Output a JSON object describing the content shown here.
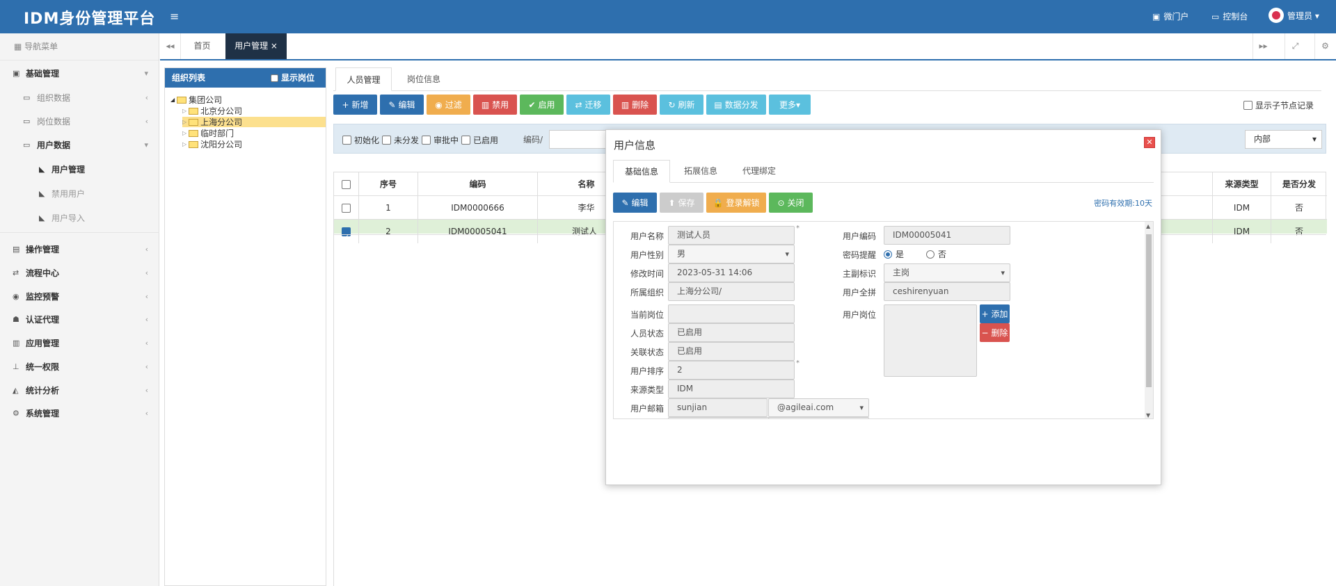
{
  "header": {
    "brand": "IDM身份管理平台",
    "menu_icon": "≡",
    "portal": "微门户",
    "console": "控制台",
    "user": "管理员 ▾"
  },
  "sidebar": {
    "title": "导航菜单",
    "groups": [
      {
        "label": "基础管理",
        "arrow": "▾"
      },
      {
        "label": "组织数据",
        "arrow": "‹"
      },
      {
        "label": "岗位数据",
        "arrow": "‹"
      },
      {
        "label": "用户数据",
        "arrow": "▾"
      },
      {
        "label": "用户管理"
      },
      {
        "label": "禁用用户"
      },
      {
        "label": "用户导入"
      },
      {
        "label": "操作管理",
        "arrow": "‹"
      },
      {
        "label": "流程中心",
        "arrow": "‹"
      },
      {
        "label": "监控预警",
        "arrow": "‹"
      },
      {
        "label": "认证代理",
        "arrow": "‹"
      },
      {
        "label": "应用管理",
        "arrow": "‹"
      },
      {
        "label": "统一权限",
        "arrow": "‹"
      },
      {
        "label": "统计分析",
        "arrow": "‹"
      },
      {
        "label": "系统管理",
        "arrow": "‹"
      }
    ]
  },
  "tabs": {
    "back": "◂◂",
    "home": "首页",
    "active": "用户管理 ×",
    "forward": "▸▸",
    "expand": "⤢",
    "gear": "⚙"
  },
  "org": {
    "title": "组织列表",
    "show_post": "显示岗位",
    "tree": [
      "集团公司",
      "北京分公司",
      "上海分公司",
      "临时部门",
      "沈阳分公司"
    ]
  },
  "main": {
    "tabs": [
      "人员管理",
      "岗位信息"
    ],
    "buttons": [
      {
        "icon": "+",
        "label": "新增"
      },
      {
        "icon": "✎",
        "label": "编辑"
      },
      {
        "icon": "◉",
        "label": "过滤"
      },
      {
        "icon": "▥",
        "label": "禁用"
      },
      {
        "icon": "✔",
        "label": "启用"
      },
      {
        "icon": "⇄",
        "label": "迁移"
      },
      {
        "icon": "▥",
        "label": "删除"
      },
      {
        "icon": "↻",
        "label": "刷新"
      },
      {
        "icon": "▤",
        "label": "数据分发"
      },
      {
        "icon": "",
        "label": "更多▾"
      }
    ],
    "show_child": "显示子节点记录",
    "filter": {
      "checks": [
        "初始化",
        "未分发",
        "审批中",
        "已启用"
      ],
      "code_label": "编码/",
      "select": "内部"
    },
    "table": {
      "headers": [
        "序号",
        "编码",
        "名称",
        "来源类型",
        "是否分发"
      ],
      "rows": [
        {
          "no": "1",
          "code": "IDM0000666",
          "name": "李华",
          "source": "IDM",
          "dist": "否"
        },
        {
          "no": "2",
          "code": "IDM00005041",
          "name": "测试人",
          "source": "IDM",
          "dist": "否"
        }
      ]
    }
  },
  "modal": {
    "title": "用户信息",
    "close": "✕",
    "tabs": [
      "基础信息",
      "拓展信息",
      "代理绑定"
    ],
    "buttons": [
      {
        "icon": "✎",
        "label": "编辑"
      },
      {
        "icon": "⬆",
        "label": "保存"
      },
      {
        "icon": "🔒",
        "label": "登录解锁"
      },
      {
        "icon": "⊙",
        "label": "关闭"
      }
    ],
    "pwd_expire": "密码有效期:10天",
    "left": [
      {
        "label": "用户名称",
        "value": "测试人员"
      },
      {
        "label": "用户性别",
        "value": "男"
      },
      {
        "label": "修改时间",
        "value": "2023-05-31 14:06"
      },
      {
        "label": "所属组织",
        "value": "上海分公司/"
      },
      {
        "label": "当前岗位",
        "value": ""
      },
      {
        "label": "人员状态",
        "value": "已启用"
      },
      {
        "label": "关联状态",
        "value": "已启用"
      },
      {
        "label": "用户排序",
        "value": "2"
      },
      {
        "label": "来源类型",
        "value": "IDM"
      },
      {
        "label": "用户邮箱",
        "value": "sunjian"
      }
    ],
    "email_domain": "@agileai.com",
    "right": [
      {
        "label": "用户编码",
        "value": "IDM00005041"
      },
      {
        "label": "密码提醒",
        "value": ""
      },
      {
        "label": "主副标识",
        "value": "主岗"
      },
      {
        "label": "用户全拼",
        "value": "ceshirenyuan"
      },
      {
        "label": "用户岗位",
        "value": ""
      }
    ],
    "radio_yes": "是",
    "radio_no": "否",
    "add": "添加",
    "remove": "删除"
  },
  "colors": {
    "primary": "#2e6fae",
    "green": "#5cb85c",
    "orange": "#f0ad4e",
    "red": "#d9534f",
    "teal": "#5bc0de"
  }
}
